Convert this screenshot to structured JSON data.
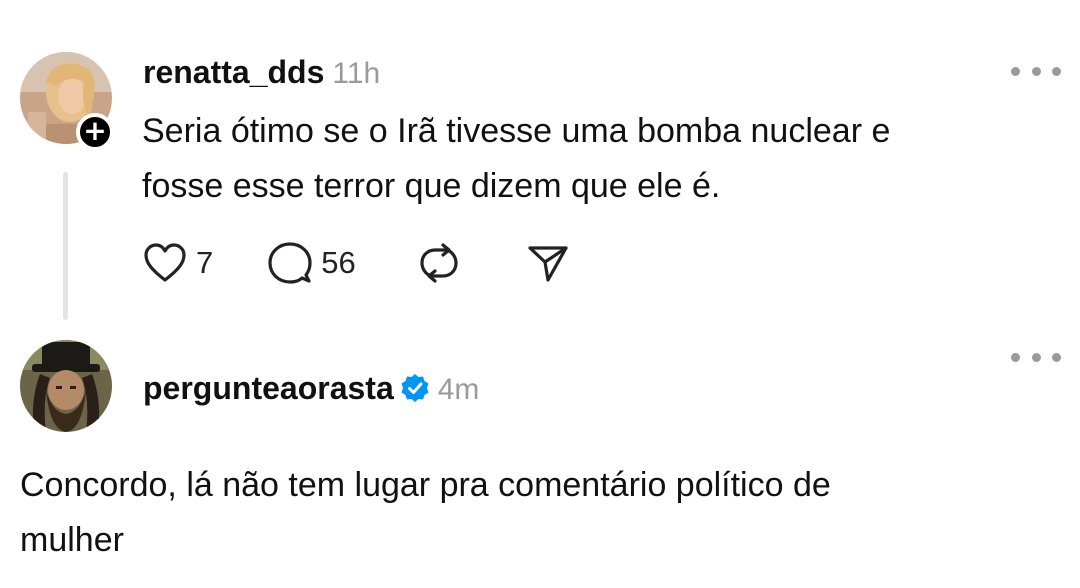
{
  "post1": {
    "username": "renatta_dds",
    "time": "11h",
    "text_line1": "Seria ótimo se o Irã tivesse uma bomba nuclear e",
    "text_line2": "fosse esse terror que dizem que ele é.",
    "likes": "7",
    "replies": "56",
    "follow_symbol": "+"
  },
  "post2": {
    "username": "pergunteaorasta",
    "time": "4m",
    "verified": true,
    "text_line1": "Concordo, lá não tem lugar pra comentário político de",
    "text_line2": "mulher"
  },
  "colors": {
    "text": "#111111",
    "secondary": "#9a9a9a",
    "verified_blue": "#0095f6",
    "thread_line": "#e3e3e3"
  },
  "icons": [
    "heart-icon",
    "comment-icon",
    "repost-icon",
    "share-icon",
    "more-icon",
    "verified-icon",
    "plus-icon"
  ]
}
